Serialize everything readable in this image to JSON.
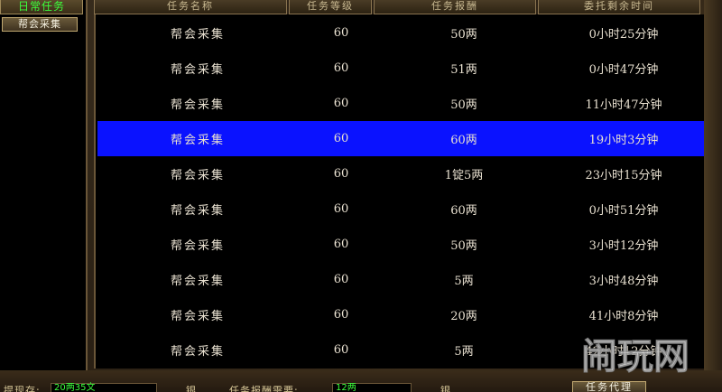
{
  "sidebar": {
    "tab_daily": "日常任务",
    "tab_guild": "帮会采集"
  },
  "table": {
    "headers": [
      "任务名称",
      "任务等级",
      "任务报酬",
      "委托剩余时间"
    ],
    "rows": [
      {
        "name": "帮会采集",
        "level": "60",
        "reward": "50两",
        "time": "0小时25分钟"
      },
      {
        "name": "帮会采集",
        "level": "60",
        "reward": "51两",
        "time": "0小时47分钟"
      },
      {
        "name": "帮会采集",
        "level": "60",
        "reward": "50两",
        "time": "11小时47分钟"
      },
      {
        "name": "帮会采集",
        "level": "60",
        "reward": "60两",
        "time": "19小时3分钟",
        "selected": true
      },
      {
        "name": "帮会采集",
        "level": "60",
        "reward": "1锭5两",
        "time": "23小时15分钟"
      },
      {
        "name": "帮会采集",
        "level": "60",
        "reward": "60两",
        "time": "0小时51分钟"
      },
      {
        "name": "帮会采集",
        "level": "60",
        "reward": "50两",
        "time": "3小时12分钟"
      },
      {
        "name": "帮会采集",
        "level": "60",
        "reward": "5两",
        "time": "3小时48分钟"
      },
      {
        "name": "帮会采集",
        "level": "60",
        "reward": "20两",
        "time": "41小时8分钟"
      },
      {
        "name": "帮会采集",
        "level": "60",
        "reward": "5两",
        "time": "42小时12分钟"
      }
    ]
  },
  "bottom": {
    "label_left": "提现存:",
    "value_left": "20两35文",
    "label_silver": "银",
    "label_need": "任务报酬需要:",
    "value_need": "12两",
    "label_silver2": "银",
    "button_agent": "任务代理"
  },
  "watermark": {
    "text": "闹玩网"
  },
  "colors": {
    "selected_row": "#0a12ff",
    "tab_daily_text": "#3cff3c"
  }
}
